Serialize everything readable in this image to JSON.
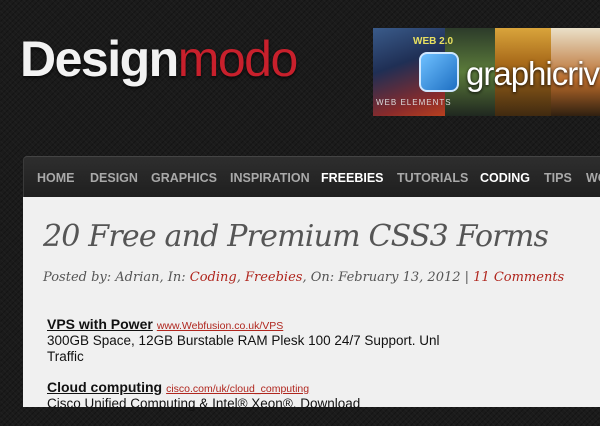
{
  "header": {
    "logo_part1": "Design",
    "logo_part2": "modo"
  },
  "banner": {
    "brand": "graphicriv",
    "small_label": "WEB 2.0",
    "strip_label": "WEB ELEMENTS"
  },
  "nav": {
    "items": [
      {
        "label": "HOME"
      },
      {
        "label": "DESIGN"
      },
      {
        "label": "GRAPHICS"
      },
      {
        "label": "INSPIRATION"
      },
      {
        "label": "FREEBIES"
      },
      {
        "label": "TUTORIALS"
      },
      {
        "label": "CODING"
      },
      {
        "label": "TIPS"
      },
      {
        "label": "WO"
      }
    ]
  },
  "article": {
    "title": "20 Free and Premium CSS3 Forms",
    "meta": {
      "posted_by_prefix": "Posted by: Adrian, In: ",
      "cat1": "Coding",
      "sep1": ", ",
      "cat2": "Freebies",
      "on_text": ", On: February 13, 2012 | ",
      "comments": "11 Comments"
    }
  },
  "ads": [
    {
      "headline": "VPS with Power",
      "url": "www.Webfusion.co.uk/VPS",
      "desc": "300GB Space, 12GB Burstable RAM Plesk 100 24/7 Support. Unl Traffic"
    },
    {
      "headline": "Cloud computing",
      "url": "cisco.com/uk/cloud_computing",
      "desc": "Cisco Unified Computing & Intel® Xeon®. Download"
    }
  ],
  "colors": {
    "accent": "#c8202c",
    "link": "#b0261e"
  }
}
